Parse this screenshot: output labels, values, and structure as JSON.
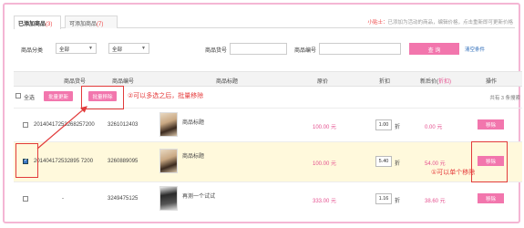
{
  "tabs": [
    {
      "label": "已添加商品",
      "count": "3"
    },
    {
      "label": "可添加商品",
      "count": "7"
    }
  ],
  "tip": {
    "label": "小贴士：",
    "text": "已添加为活动的商品，编辑价格，点击重新即可更新价格"
  },
  "search": {
    "category_label": "商品分类",
    "category_value": "全部",
    "second_value": "全部",
    "goods_no_label": "商品货号",
    "goods_code_label": "商品编号",
    "query_button": "查 询",
    "clear_link": "清空条件"
  },
  "table": {
    "headers": [
      "商品货号",
      "商品编号",
      "商品标题",
      "原价",
      "折扣",
      "折后价(元/件)",
      "操作"
    ],
    "headers_display": {
      "goods_no": "商品货号",
      "goods_code": "商品编号",
      "title": "商品标题",
      "orig_price": "原价",
      "discount": "折扣",
      "after_price": "新后价(",
      "after_price_suffix": "折扣)",
      "action": "操作"
    },
    "select_all": "全选",
    "batch_update": "批量更新",
    "batch_remove": "批量移除",
    "annotation_batch": "②可以多选之后，批量移除",
    "page_info": "共有 3 条搜索",
    "rows": [
      {
        "goods_no": "20140417253268257200",
        "goods_code": "3261012403",
        "title": "商品标题",
        "orig_price": "100.00 元",
        "discount": "1.00",
        "discount_unit": "折",
        "after_price": "0.00 元",
        "action": "移除",
        "checked": false
      },
      {
        "goods_no": "201404172532895 7200",
        "goods_code": "3260889095",
        "title": "商品标题",
        "orig_price": "100.00 元",
        "discount": "5.40",
        "discount_unit": "折",
        "after_price": "54.00 元",
        "action": "移除",
        "checked": true
      },
      {
        "goods_no": "-",
        "goods_code": "3249475125",
        "title": "再测一个试试",
        "orig_price": "333.00 元",
        "discount": "1.16",
        "discount_unit": "折",
        "after_price": "38.60 元",
        "action": "移除",
        "checked": false
      }
    ],
    "annotation_single": "①可以单个移除"
  },
  "colors": {
    "accent": "#f276ad",
    "annotation": "#e23b3b",
    "frame": "#f4b6d4",
    "highlight_row": "#fff9dc"
  }
}
